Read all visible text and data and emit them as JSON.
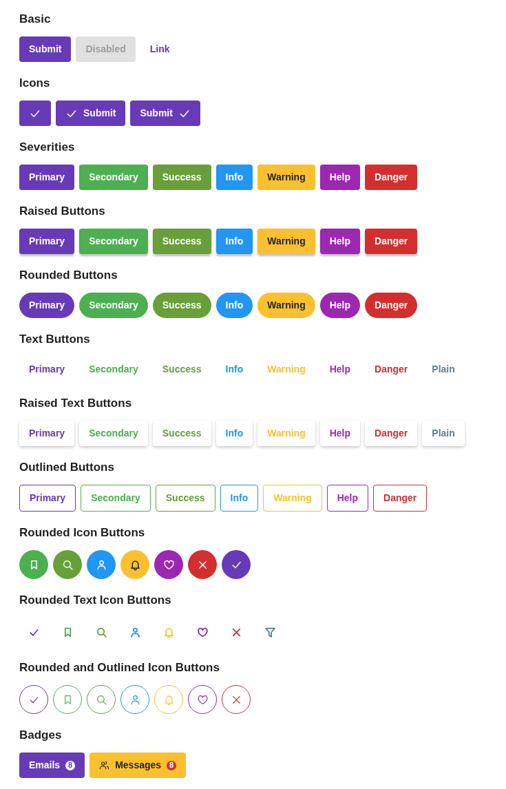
{
  "sections": [
    {
      "title": "Basic",
      "kind": "basic",
      "buttons": [
        {
          "label": "Submit",
          "kind": "solid",
          "disabled": false,
          "color": "#673ab7"
        },
        {
          "label": "Disabled",
          "disabled": true
        },
        {
          "label": "Link",
          "kind": "link",
          "disabled": false,
          "color": "#673ab7"
        }
      ]
    },
    {
      "title": "Icons",
      "kind": "icons",
      "buttons": [
        {
          "kind": "icon-only",
          "color": "#673ab7"
        },
        {
          "label": "Submit",
          "kind": "icon-left",
          "color": "#673ab7"
        },
        {
          "label": "Submit",
          "kind": "icon-right",
          "color": "#673ab7"
        }
      ]
    },
    {
      "title": "Severities",
      "kind": "solid",
      "buttons": [
        {
          "label": "Primary",
          "color": "#673ab7"
        },
        {
          "label": "Secondary",
          "color": "#4caf50"
        },
        {
          "label": "Success",
          "color": "#689f38"
        },
        {
          "label": "Info",
          "color": "#2196f3"
        },
        {
          "label": "Warning",
          "color": "#fbc02d"
        },
        {
          "label": "Help",
          "color": "#9c27b0"
        },
        {
          "label": "Danger",
          "color": "#d32f2f"
        }
      ]
    },
    {
      "title": "Raised Buttons",
      "kind": "raised",
      "buttons": [
        {
          "label": "Primary",
          "color": "#673ab7"
        },
        {
          "label": "Secondary",
          "color": "#4caf50"
        },
        {
          "label": "Success",
          "color": "#689f38"
        },
        {
          "label": "Info",
          "color": "#2196f3"
        },
        {
          "label": "Warning",
          "color": "#fbc02d"
        },
        {
          "label": "Help",
          "color": "#9c27b0"
        },
        {
          "label": "Danger",
          "color": "#d32f2f"
        }
      ]
    },
    {
      "title": "Rounded Buttons",
      "kind": "rounded",
      "buttons": [
        {
          "label": "Primary",
          "color": "#673ab7"
        },
        {
          "label": "Secondary",
          "color": "#4caf50"
        },
        {
          "label": "Success",
          "color": "#689f38"
        },
        {
          "label": "Info",
          "color": "#2196f3"
        },
        {
          "label": "Warning",
          "color": "#fbc02d"
        },
        {
          "label": "Help",
          "color": "#9c27b0"
        },
        {
          "label": "Danger",
          "color": "#d32f2f"
        }
      ]
    },
    {
      "title": "Text Buttons",
      "kind": "text",
      "buttons": [
        {
          "label": "Primary",
          "color": "#673ab7"
        },
        {
          "label": "Secondary",
          "color": "#4caf50"
        },
        {
          "label": "Success",
          "color": "#689f38"
        },
        {
          "label": "Info",
          "color": "#2196f3"
        },
        {
          "label": "Warning",
          "color": "#fbc02d"
        },
        {
          "label": "Help",
          "color": "#9c27b0"
        },
        {
          "label": "Danger",
          "color": "#d32f2f"
        },
        {
          "label": "Plain",
          "color": "#607d8b"
        }
      ]
    },
    {
      "title": "Raised Text Buttons",
      "kind": "raised-text",
      "buttons": [
        {
          "label": "Primary",
          "color": "#673ab7"
        },
        {
          "label": "Secondary",
          "color": "#4caf50"
        },
        {
          "label": "Success",
          "color": "#689f38"
        },
        {
          "label": "Info",
          "color": "#2196f3"
        },
        {
          "label": "Warning",
          "color": "#fbc02d"
        },
        {
          "label": "Help",
          "color": "#9c27b0"
        },
        {
          "label": "Danger",
          "color": "#d32f2f"
        },
        {
          "label": "Plain",
          "color": "#607d8b"
        }
      ]
    },
    {
      "title": "Outlined Buttons",
      "kind": "outlined",
      "buttons": [
        {
          "label": "Primary",
          "color": "#673ab7"
        },
        {
          "label": "Secondary",
          "color": "#4caf50"
        },
        {
          "label": "Success",
          "color": "#689f38"
        },
        {
          "label": "Info",
          "color": "#2196f3"
        },
        {
          "label": "Warning",
          "color": "#fbc02d"
        },
        {
          "label": "Help",
          "color": "#9c27b0"
        },
        {
          "label": "Danger",
          "color": "#d32f2f"
        }
      ]
    },
    {
      "title": "Rounded Icon Buttons",
      "kind": "round-icon",
      "buttons": [
        {
          "kind": "bookmark",
          "color": "#4caf50"
        },
        {
          "kind": "search",
          "color": "#689f38"
        },
        {
          "kind": "user",
          "color": "#2196f3"
        },
        {
          "kind": "bell",
          "color": "#fbc02d"
        },
        {
          "kind": "heart",
          "color": "#9c27b0"
        },
        {
          "kind": "times",
          "color": "#d32f2f"
        },
        {
          "kind": "check",
          "color": "#673ab7"
        }
      ]
    },
    {
      "title": "Rounded Text Icon Buttons",
      "kind": "text-icon",
      "buttons": [
        {
          "kind": "check",
          "color": "#673ab7"
        },
        {
          "kind": "bookmark",
          "color": "#4caf50"
        },
        {
          "kind": "search",
          "color": "#689f38"
        },
        {
          "kind": "user",
          "color": "#2196f3"
        },
        {
          "kind": "bell",
          "color": "#fbc02d"
        },
        {
          "kind": "heart",
          "color": "#9c27b0"
        },
        {
          "kind": "times",
          "color": "#d32f2f"
        },
        {
          "kind": "filter",
          "color": "#607d8b"
        }
      ]
    },
    {
      "title": "Rounded and Outlined Icon Buttons",
      "kind": "outline-icon",
      "buttons": [
        {
          "kind": "check",
          "color": "#673ab7"
        },
        {
          "kind": "bookmark",
          "color": "#4caf50"
        },
        {
          "kind": "search",
          "color": "#689f38"
        },
        {
          "kind": "user",
          "color": "#2196f3"
        },
        {
          "kind": "bell",
          "color": "#fbc02d"
        },
        {
          "kind": "heart",
          "color": "#9c27b0"
        },
        {
          "kind": "times",
          "color": "#d32f2f"
        }
      ]
    },
    {
      "title": "Badges",
      "kind": "badges",
      "buttons": [
        {
          "label": "Emails",
          "kind": "plain",
          "color": "#673ab7",
          "badge": {
            "text": "8",
            "color": "#ffffff"
          }
        },
        {
          "label": "Messages",
          "kind": "users",
          "color": "#fbc02d",
          "badge": {
            "text": "8",
            "color": "#d32f2f"
          }
        }
      ]
    }
  ]
}
